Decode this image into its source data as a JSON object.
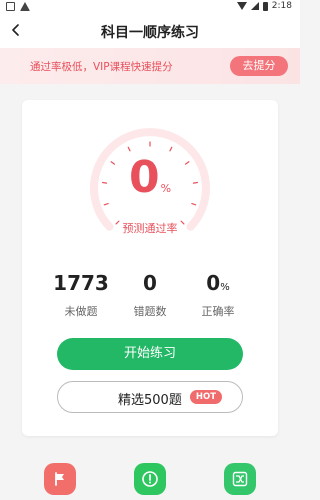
{
  "status_bar": {
    "time": "2:18",
    "icons": [
      "image-icon",
      "warning-icon",
      "wifi-icon",
      "signal-icon",
      "battery-icon"
    ]
  },
  "header": {
    "title": "科目一顺序练习",
    "back_icon": "arrow-left-icon"
  },
  "promo": {
    "text": "通过率极低，VIP课程快速提分",
    "button_label": "去提分"
  },
  "progress": {
    "value": "0",
    "unit": "%",
    "label": "预测通过率"
  },
  "stats": [
    {
      "value": "1773",
      "unit": "",
      "label": "未做题"
    },
    {
      "value": "0",
      "unit": "",
      "label": "错题数"
    },
    {
      "value": "0",
      "unit": "%",
      "label": "正确率"
    }
  ],
  "actions": {
    "start_label": "开始练习",
    "selected_label": "精选500题",
    "hot_badge": "HOT"
  },
  "toolbar": [
    {
      "icon": "flag-icon",
      "color": "#f16e6a"
    },
    {
      "icon": "exclamation-icon",
      "color": "#2ec65e"
    },
    {
      "icon": "shuffle-icon",
      "color": "#34c66b"
    }
  ],
  "colors": {
    "accent_red": "#e8505b",
    "accent_green": "#22b866",
    "gauge_ring": "#fde7e8"
  }
}
